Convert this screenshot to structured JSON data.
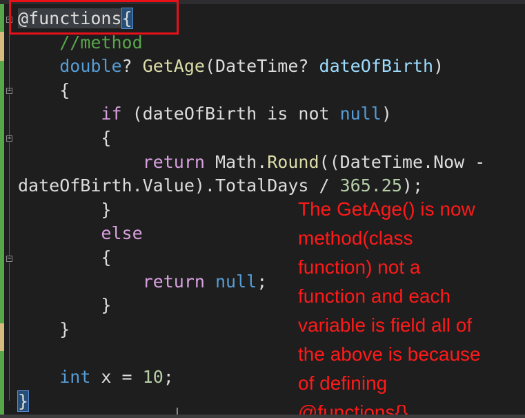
{
  "code": {
    "lines": [
      [
        {
          "t": "@",
          "c": "razor"
        },
        {
          "t": "functions",
          "c": "razor"
        },
        {
          "t": "{",
          "c": "brace-hl"
        }
      ],
      [
        {
          "t": "    "
        },
        {
          "t": "//method",
          "c": "cm"
        }
      ],
      [
        {
          "t": "    "
        },
        {
          "t": "double",
          "c": "kw"
        },
        {
          "t": "? "
        },
        {
          "t": "GetAge",
          "c": "fn"
        },
        {
          "t": "(DateTime? "
        },
        {
          "t": "dateOfBirth",
          "c": "par"
        },
        {
          "t": ")"
        }
      ],
      [
        {
          "t": "    {"
        }
      ],
      [
        {
          "t": "        "
        },
        {
          "t": "if",
          "c": "ctl"
        },
        {
          "t": " (dateOfBirth is not "
        },
        {
          "t": "null",
          "c": "kw"
        },
        {
          "t": ")"
        }
      ],
      [
        {
          "t": "        {"
        }
      ],
      [
        {
          "t": "            "
        },
        {
          "t": "return",
          "c": "ctl"
        },
        {
          "t": " Math."
        },
        {
          "t": "Round",
          "c": "fn"
        },
        {
          "t": "((DateTime.Now -"
        }
      ],
      [
        {
          "t": "dateOfBirth.Value).TotalDays / "
        },
        {
          "t": "365.25",
          "c": "num"
        },
        {
          "t": ");"
        }
      ],
      [
        {
          "t": "        }"
        }
      ],
      [
        {
          "t": "        "
        },
        {
          "t": "else",
          "c": "ctl"
        }
      ],
      [
        {
          "t": "        {"
        }
      ],
      [
        {
          "t": "            "
        },
        {
          "t": "return",
          "c": "ctl"
        },
        {
          "t": " "
        },
        {
          "t": "null",
          "c": "kw"
        },
        {
          "t": ";"
        }
      ],
      [
        {
          "t": "        }"
        }
      ],
      [
        {
          "t": "    }"
        }
      ],
      [
        {
          "t": ""
        }
      ],
      [
        {
          "t": "    "
        },
        {
          "t": "int",
          "c": "kw"
        },
        {
          "t": " x = "
        },
        {
          "t": "10",
          "c": "num"
        },
        {
          "t": ";"
        }
      ],
      [
        {
          "t": "}",
          "c": "brace-hl"
        }
      ]
    ]
  },
  "annotation": {
    "text": "The GetAge() is now\nmethod(class\nfunction) not a\nfunction and each\nvariable is field all of\nthe above is because\nof defining\n@functions{}"
  },
  "colors": {
    "background": "#1e1e1e",
    "highlight_box": "#e8111a",
    "annotation": "#ff1a1a",
    "change_bar_green": "#57a64a",
    "change_bar_yellow": "#d7ba7d"
  },
  "icons": {
    "fold": "collapse-minus-icon",
    "cursor": "text-cursor-icon"
  }
}
